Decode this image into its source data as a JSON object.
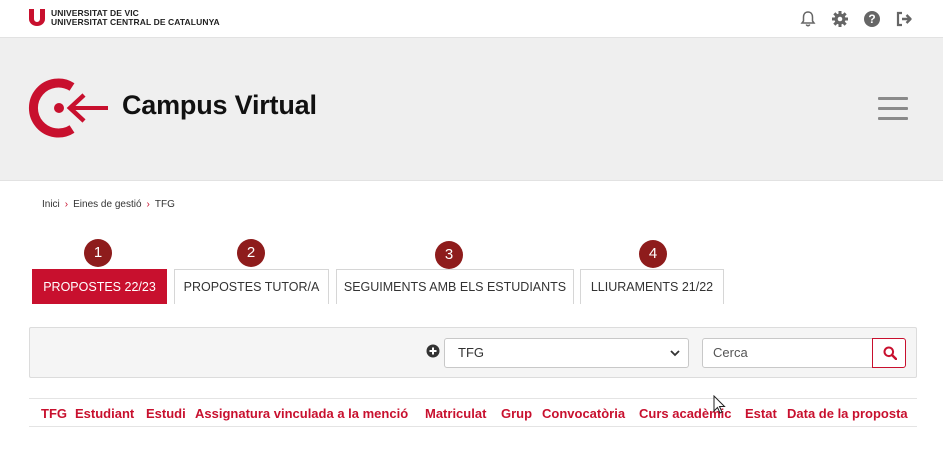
{
  "university": {
    "line1": "UNIVERSITAT DE VIC",
    "line2": "UNIVERSITAT CENTRAL DE CATALUNYA"
  },
  "top_icons": [
    "bell-icon",
    "gear-icon",
    "help-icon",
    "logout-icon"
  ],
  "header": {
    "title": "Campus Virtual"
  },
  "breadcrumb": {
    "items": [
      "Inici",
      "Eines de gestió",
      "TFG"
    ],
    "separator": "›"
  },
  "tabs": [
    {
      "badge": "1",
      "label": "PROPOSTES 22/23",
      "active": true
    },
    {
      "badge": "2",
      "label": "PROPOSTES TUTOR/A",
      "active": false
    },
    {
      "badge": "3",
      "label": "SEGUIMENTS AMB ELS ESTUDIANTS",
      "active": false
    },
    {
      "badge": "4",
      "label": "LLIURAMENTS 21/22",
      "active": false
    }
  ],
  "filter": {
    "select_value": "TFG",
    "search_placeholder": "Cerca"
  },
  "table": {
    "columns": [
      "TFG",
      "Estudiant",
      "Estudi",
      "Assignatura vinculada a la menció",
      "Matriculat",
      "Grup",
      "Convocatòria",
      "Curs acadèmic",
      "Estat",
      "Data de la proposta"
    ]
  },
  "colors": {
    "brand": "#c8102e",
    "badge": "#8e1c1c",
    "band": "#efefef"
  }
}
